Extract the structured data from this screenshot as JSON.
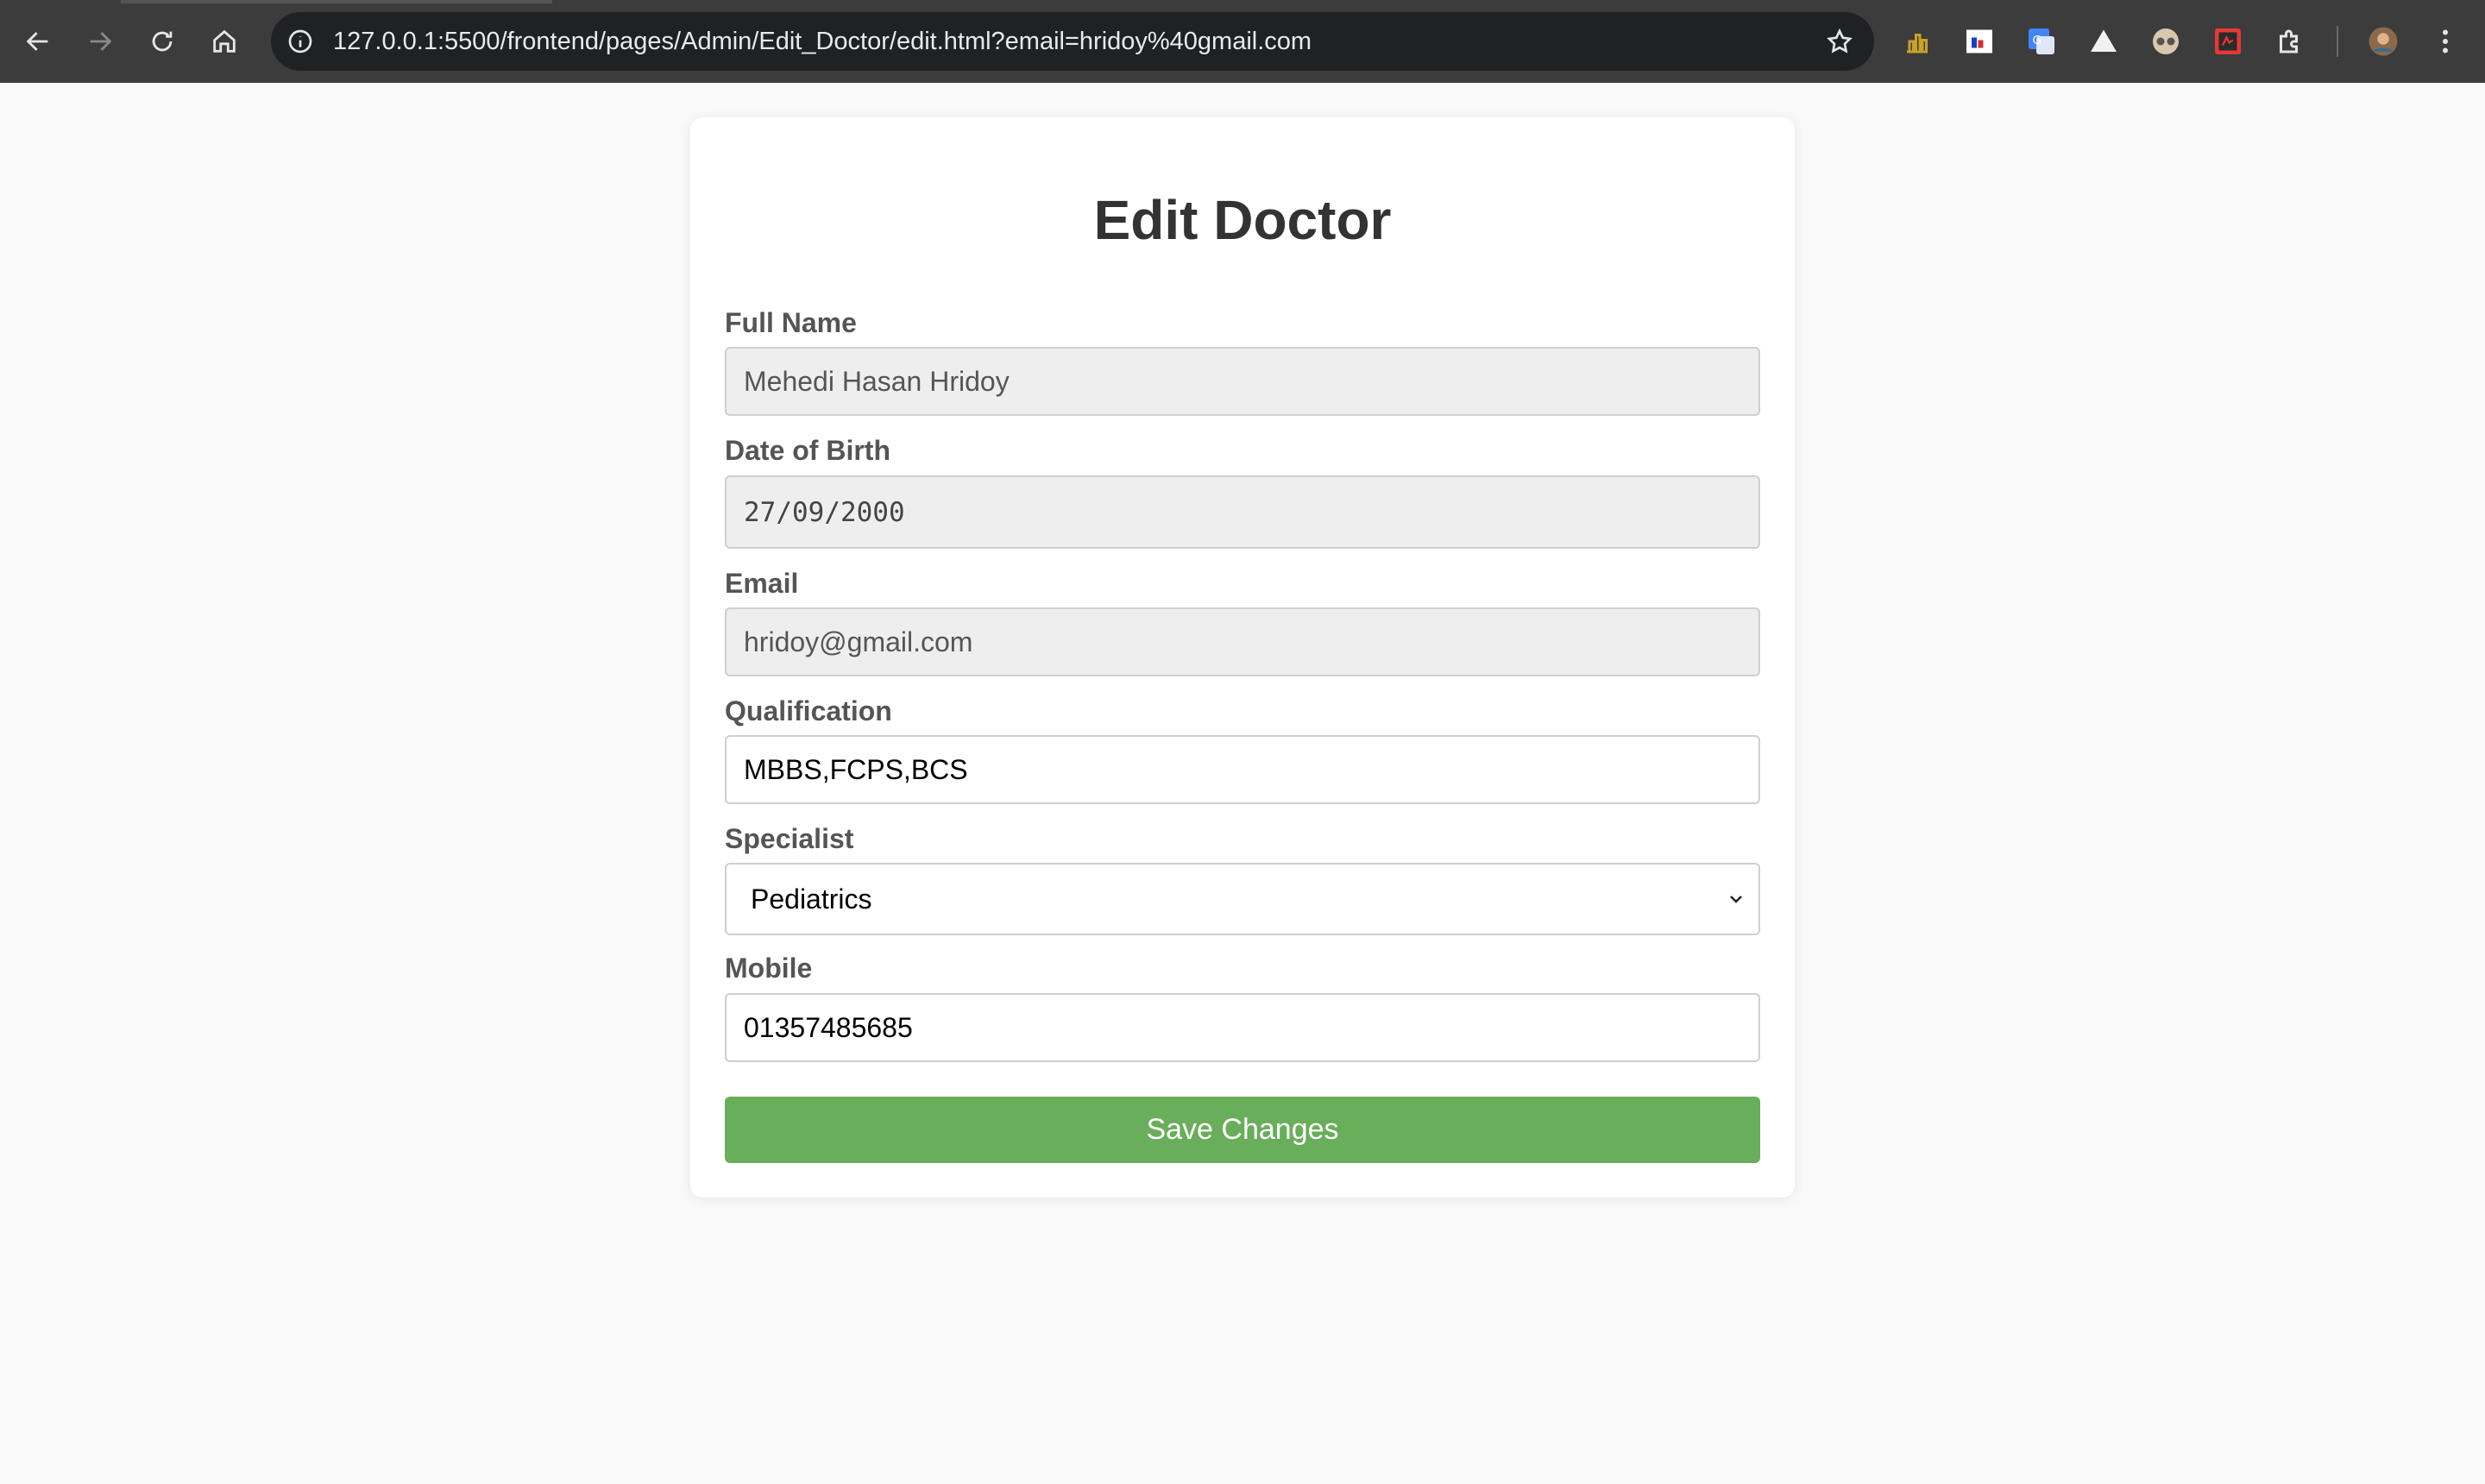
{
  "browser": {
    "url": "127.0.0.1:5500/frontend/pages/Admin/Edit_Doctor/edit.html?email=hridoy%40gmail.com"
  },
  "form": {
    "title": "Edit Doctor",
    "full_name": {
      "label": "Full Name",
      "value": "Mehedi Hasan Hridoy"
    },
    "dob": {
      "label": "Date of Birth",
      "value": "27/09/2000"
    },
    "email": {
      "label": "Email",
      "value": "hridoy@gmail.com"
    },
    "qualification": {
      "label": "Qualification",
      "value": "MBBS,FCPS,BCS"
    },
    "specialist": {
      "label": "Specialist",
      "selected": "Pediatrics"
    },
    "mobile": {
      "label": "Mobile",
      "value": "01357485685"
    },
    "save_label": "Save Changes"
  },
  "colors": {
    "save_button": "#69ae5b",
    "page_background": "#f9f9f9",
    "chrome_background": "#3c3c3c"
  }
}
